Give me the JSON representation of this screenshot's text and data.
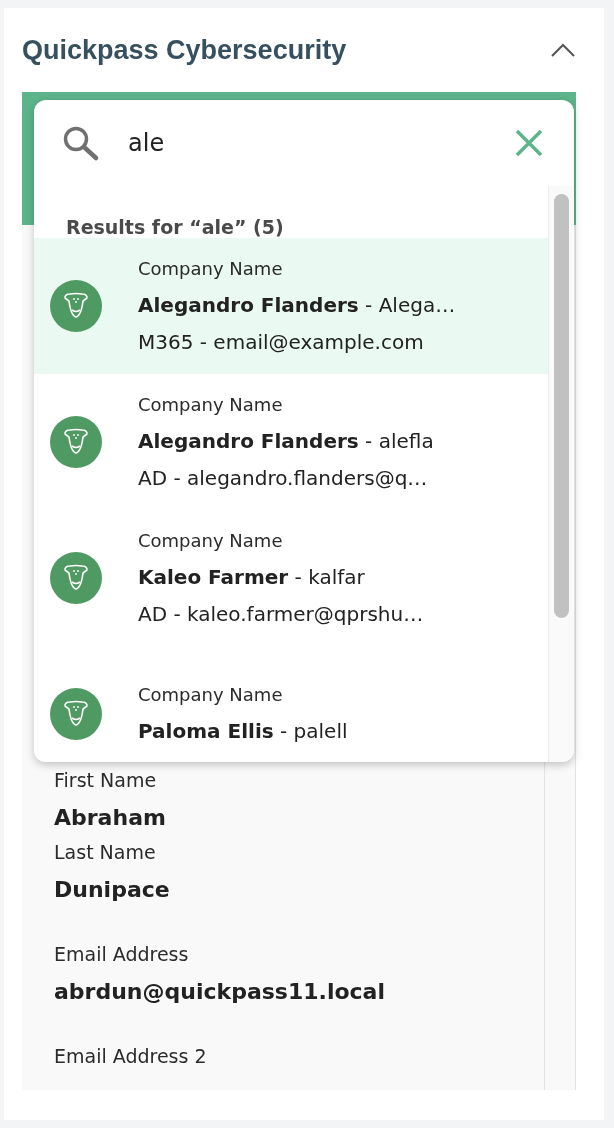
{
  "header": {
    "title": "Quickpass Cybersecurity",
    "expanded": true
  },
  "search": {
    "value": "ale",
    "results_label": "Results for “ale” (5)"
  },
  "results": [
    {
      "company": "Company Name",
      "name": "Alegandro Flanders",
      "username": "- Alega…",
      "detail": "M365 - email@example.com",
      "selected": true
    },
    {
      "company": "Company Name",
      "name": "Alegandro Flanders",
      "username": "- alefla",
      "detail": "AD - alegandro.flanders@q…",
      "selected": false
    },
    {
      "company": "Company Name",
      "name": "Kaleo Farmer",
      "username": "- kalfar",
      "detail": "AD - kaleo.farmer@qprshu…",
      "selected": false
    },
    {
      "company": "Company Name",
      "name": "Paloma Ellis",
      "username": "- palell",
      "selected": false
    }
  ],
  "fields": [
    {
      "label": "First Name",
      "value": "Abraham"
    },
    {
      "label": "Last Name",
      "value": "Dunipace"
    },
    {
      "label": "Email Address",
      "value": "abrdun@quickpass11.local"
    },
    {
      "label": "Email Address 2"
    }
  ]
}
